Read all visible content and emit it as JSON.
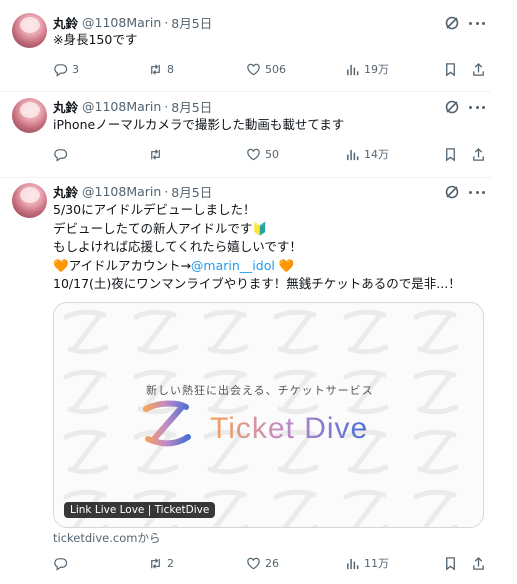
{
  "tweets": [
    {
      "name": "丸鈴",
      "handle": "@1108Marin",
      "date": "8月5日",
      "lines": [
        "※身長150です"
      ],
      "stats": {
        "replies": "3",
        "reposts": "8",
        "likes": "506",
        "views": "19万"
      }
    },
    {
      "name": "丸鈴",
      "handle": "@1108Marin",
      "date": "8月5日",
      "lines": [
        "iPhoneノーマルカメラで撮影した動画も載せてます"
      ],
      "stats": {
        "replies": "",
        "reposts": "",
        "likes": "50",
        "views": "14万"
      }
    },
    {
      "name": "丸鈴",
      "handle": "@1108Marin",
      "date": "8月5日",
      "lines": [
        "5/30にアイドルデビューしました！",
        "デビューしたての新人アイドルです🔰",
        "もしよければ応援してくれたら嬉しいです！",
        "🧡アイドルアカウント→",
        "10/17(土)夜にワンマンライブやります！無銭チケットあるので是非...！"
      ],
      "mention": "@marin__idol",
      "mention_suffix": " 🧡",
      "stats": {
        "replies": "",
        "reposts": "2",
        "likes": "26",
        "views": "11万"
      }
    }
  ],
  "card": {
    "tagline": "新しい熱狂に出会える、チケットサービス",
    "logo_text": "Ticket Dive",
    "overlay": "Link Live Love | TicketDive",
    "source": "ticketdive.comから"
  },
  "colors": {
    "text": "#0f1419",
    "muted": "#536471",
    "link": "#1d9bf0",
    "border": "#eff3f4"
  }
}
